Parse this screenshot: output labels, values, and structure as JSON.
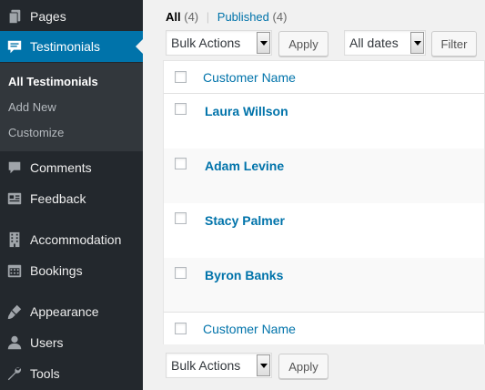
{
  "sidebar": {
    "items": [
      {
        "label": "Pages",
        "icon": "pages-icon"
      },
      {
        "label": "Testimonials",
        "icon": "testimonials-icon"
      },
      {
        "label": "Comments",
        "icon": "comments-icon"
      },
      {
        "label": "Feedback",
        "icon": "feedback-icon"
      },
      {
        "label": "Accommodation",
        "icon": "accommodation-icon"
      },
      {
        "label": "Bookings",
        "icon": "bookings-icon"
      },
      {
        "label": "Appearance",
        "icon": "appearance-icon"
      },
      {
        "label": "Users",
        "icon": "users-icon"
      },
      {
        "label": "Tools",
        "icon": "tools-icon"
      }
    ],
    "submenu": [
      {
        "label": "All Testimonials"
      },
      {
        "label": "Add New"
      },
      {
        "label": "Customize"
      }
    ]
  },
  "views": {
    "all_label": "All",
    "all_count": "(4)",
    "separator": "|",
    "published_label": "Published",
    "published_count": "(4)"
  },
  "top_actions": {
    "bulk_selected": "Bulk Actions",
    "apply_label": "Apply",
    "dates_selected": "All dates",
    "filter_label": "Filter"
  },
  "table": {
    "header_column": "Customer Name",
    "footer_column": "Customer Name",
    "rows": [
      {
        "name": "Laura Willson"
      },
      {
        "name": "Adam Levine"
      },
      {
        "name": "Stacy Palmer"
      },
      {
        "name": "Byron Banks"
      }
    ]
  },
  "bottom_actions": {
    "bulk_selected": "Bulk Actions",
    "apply_label": "Apply"
  },
  "colors": {
    "sidebar_bg": "#23282d",
    "submenu_bg": "#32373c",
    "accent": "#0073aa",
    "page_bg": "#f1f1f1"
  }
}
